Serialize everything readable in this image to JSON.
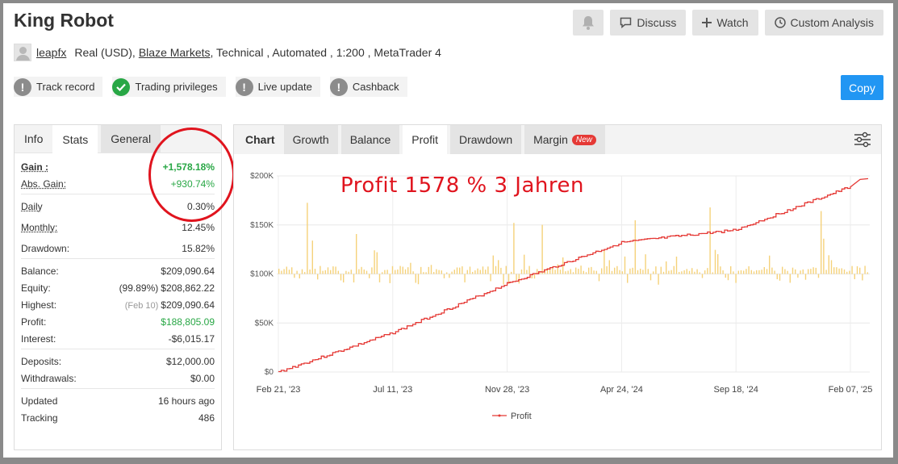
{
  "header": {
    "title": "King Robot"
  },
  "toolbar": {
    "discuss": "Discuss",
    "watch": "Watch",
    "custom": "Custom Analysis",
    "copy": "Copy"
  },
  "meta": {
    "user": "leapfx",
    "account_type": "Real (USD),",
    "broker": "Blaze Markets",
    "rest": ", Technical , Automated , 1:200 , MetaTrader 4"
  },
  "badges": [
    {
      "label": "Track record",
      "icon": "exclamation-icon"
    },
    {
      "label": "Trading privileges",
      "icon": "check-icon"
    },
    {
      "label": "Live update",
      "icon": "exclamation-icon"
    },
    {
      "label": "Cashback",
      "icon": "exclamation-icon"
    }
  ],
  "left_tabs": [
    "Info",
    "Stats",
    "General"
  ],
  "stats": {
    "gain_label": "Gain :",
    "gain": "+1,578.18%",
    "abs_gain_label": "Abs. Gain:",
    "abs_gain": "+930.74%",
    "daily_label": "Daily",
    "daily": "0.30%",
    "monthly_label": "Monthly:",
    "monthly": "12.45%",
    "drawdown_label": "Drawdown:",
    "drawdown": "15.82%",
    "balance_label": "Balance:",
    "balance": "$209,090.64",
    "equity_label": "Equity:",
    "equity_pct": "(99.89%)",
    "equity": "$208,862.22",
    "highest_label": "Highest:",
    "highest_date": "(Feb 10)",
    "highest": "$209,090.64",
    "profit_label": "Profit:",
    "profit": "$188,805.09",
    "interest_label": "Interest:",
    "interest": "-$6,015.17",
    "deposits_label": "Deposits:",
    "deposits": "$12,000.00",
    "withdrawals_label": "Withdrawals:",
    "withdrawals": "$0.00",
    "updated_label": "Updated",
    "updated": "16 hours ago",
    "tracking_label": "Tracking",
    "tracking": "486"
  },
  "right_tabs": [
    "Chart",
    "Growth",
    "Balance",
    "Profit",
    "Drawdown",
    "Margin"
  ],
  "new_tag": "New",
  "annotation": "Profit 1578 % 3 Jahren",
  "colors": {
    "accent": "#2196f3",
    "green": "#28a745",
    "profit_line": "#e53935",
    "bars": "#f5d27a",
    "annotation": "#e0141e"
  },
  "chart_data": {
    "type": "line",
    "x_ticks": [
      "Feb 21, '23",
      "Jul 11, '23",
      "Nov 28, '23",
      "Apr 24, '24",
      "Sep 18, '24",
      "Feb 07, '25"
    ],
    "y_ticks": [
      "$0",
      "$50K",
      "$100K",
      "$150K",
      "$200K"
    ],
    "ylim": [
      0,
      200000
    ],
    "legend": "Profit",
    "series": [
      {
        "name": "Profit",
        "x": [
          "Feb 21, '23",
          "Jul 11, '23",
          "Nov 28, '23",
          "Apr 24, '24",
          "Sep 18, '24",
          "Feb 07, '25"
        ],
        "values": [
          0,
          40000,
          90000,
          132000,
          145000,
          189000
        ]
      }
    ]
  }
}
